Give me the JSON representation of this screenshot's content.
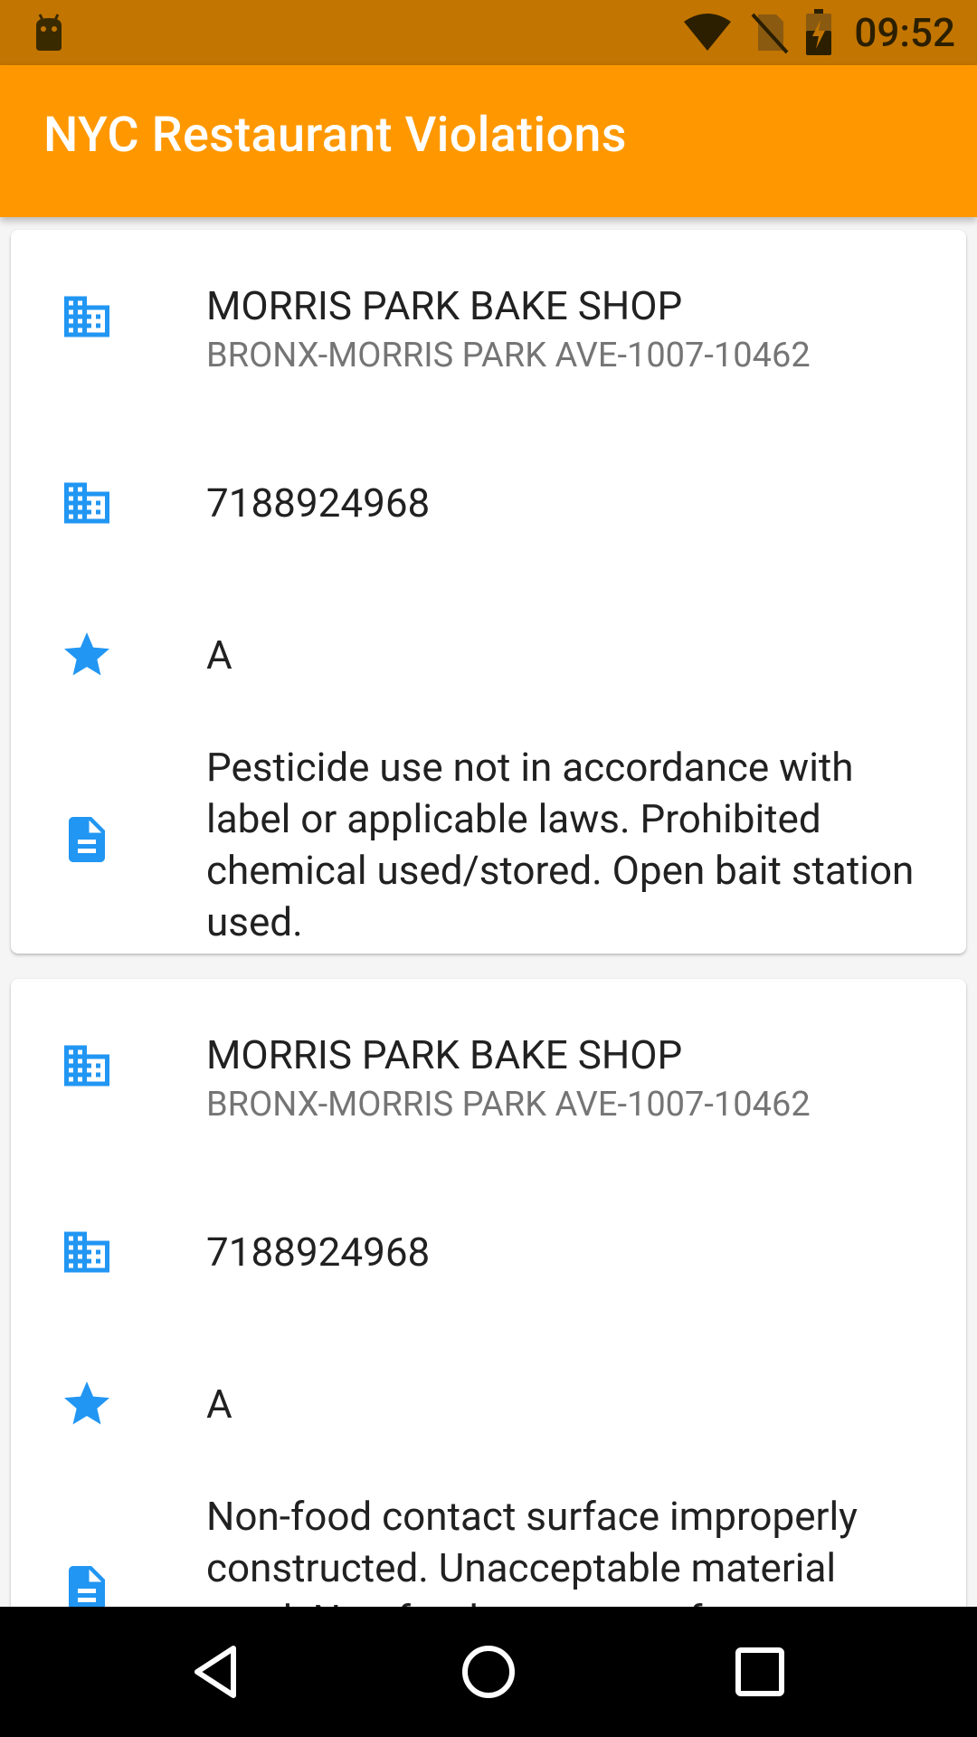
{
  "status_bar": {
    "time": "09:52",
    "icons": [
      "android-icon",
      "wifi-icon",
      "no-sim-icon",
      "battery-charging-icon"
    ]
  },
  "app_bar": {
    "title": "NYC Restaurant Violations"
  },
  "colors": {
    "status_bar": "#c27500",
    "app_bar": "#ff9800",
    "icon_accent": "#2196f3",
    "primary_text": "#212121",
    "secondary_text": "#757575"
  },
  "cards": [
    {
      "name": "MORRIS PARK BAKE SHOP",
      "address": "BRONX-MORRIS PARK AVE-1007-10462",
      "phone": "7188924968",
      "grade": "A",
      "violation": "Pesticide use not in accordance with label or applicable laws. Prohibited chemical used/stored. Open bait station used."
    },
    {
      "name": "MORRIS PARK BAKE SHOP",
      "address": "BRONX-MORRIS PARK AVE-1007-10462",
      "phone": "7188924968",
      "grade": "A",
      "violation": "Non-food contact surface improperly constructed. Unacceptable material used. Non-food contact surface or"
    }
  ],
  "nav_bar": {
    "buttons": [
      "back-icon",
      "home-icon",
      "recents-icon"
    ]
  }
}
